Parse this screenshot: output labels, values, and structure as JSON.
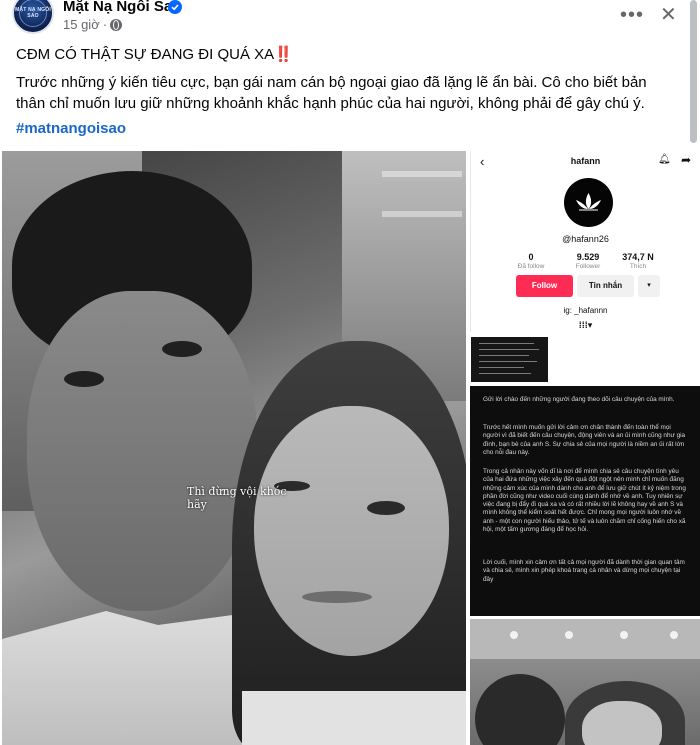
{
  "page": {
    "name": "Mặt Nạ Ngôi Sao",
    "time": "15 giờ",
    "avatar_text": "MẶT NẠ NGÔI SAO"
  },
  "post": {
    "headline": "CĐM CÓ THẬT SỰ ĐANG ĐI QUÁ XA‼️",
    "body": "Trước những ý kiến tiêu cực, bạn gái nam cán bộ ngoại giao đã lặng lẽ ẩn bài. Cô cho biết bản thân chỉ muốn lưu giữ những khoảnh khắc hạnh phúc của hai người, không phải để gây chú ý.",
    "hashtag": "#matnangoisao"
  },
  "photo_caption": {
    "line1": "Thì đừng vội khóc",
    "line2": "hãy"
  },
  "profile": {
    "username": "hafann",
    "handle": "@hafann26",
    "stats": [
      {
        "num": "0",
        "label": "Đã follow"
      },
      {
        "num": "9.529",
        "label": "Follower"
      },
      {
        "num": "374,7 N",
        "label": "Thích"
      }
    ],
    "follow_label": "Follow",
    "message_label": "Tin nhắn",
    "dropdown_label": "▾",
    "ig_text": "ig: _hafannn",
    "grid_icon_text": "⁞⁞⁞▾"
  },
  "statement": {
    "paragraphs": [
      "Gửi lời chào đến những người đang theo dõi câu chuyện của mình.",
      "Trước hết mình muốn gửi lời cảm ơn chân thành đến toàn thể mọi người vì đã biết đến câu chuyện, động viên và an ủi mình cũng như gia đình, bạn bè của anh S. Sự chia sẻ của mọi người là niềm an ủi rất lớn cho nỗi đau này.",
      "Trong cả nhân này vốn dĩ là nơi để mình chia sẻ câu chuyện tình yêu của hai đứa những việc xảy đến quá đột ngột nên mình chỉ muốn đăng những cảm xúc của mình dành cho anh để lưu giữ chút ít kỷ niệm trong phần đời cũng như video cuối cùng dành để nhớ về anh. Tuy nhiên sự việc đang bị đẩy đi quá xa và có rất nhiều lời lẽ không hay về anh S và mình không thể kiểm soát hết được. Chỉ mong mọi người luôn nhớ về anh - một con người hiếu thảo, tử tế và luôn chăm chỉ cống hiến cho xã hội, một tấm gương đáng để học hỏi.",
      "Lời cuối, mình xin cảm ơn tất cả mọi người đã dành thời gian quan tâm và chia sẻ, mình xin phép khoá trang cá nhân và dừng mọi chuyện tại đây"
    ]
  },
  "colors": {
    "link": "#1b66c9",
    "verified": "#0866ff",
    "follow_button": "#fe2c55"
  },
  "icons": [
    "verified-badge-icon",
    "globe-icon",
    "more-options-icon",
    "close-icon",
    "back-arrow-icon",
    "bell-icon",
    "share-icon",
    "lotus-icon"
  ]
}
